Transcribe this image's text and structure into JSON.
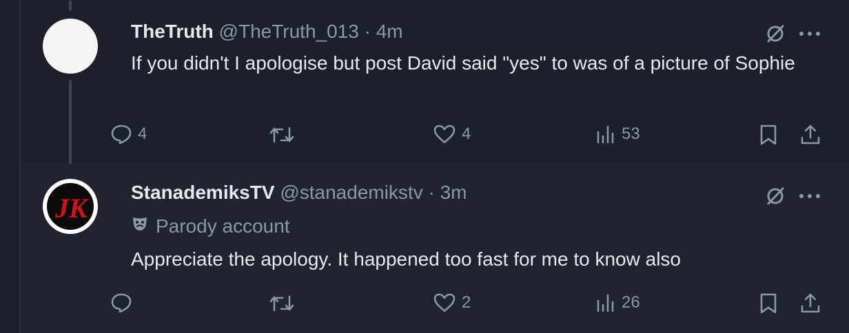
{
  "posts": [
    {
      "name": "TheTruth",
      "handle": "@TheTruth_013",
      "separator": "·",
      "time": "4m",
      "text": "If you didn't I apologise but post David said \"yes\" to was of a picture of Sophie",
      "replies": "4",
      "reposts": "",
      "likes": "4",
      "views": "53"
    },
    {
      "name": "StanademiksTV",
      "handle": "@stanademikstv",
      "separator": "·",
      "time": "3m",
      "badge": "Parody account",
      "text": "Appreciate the apology. It happened too fast for me to know also",
      "replies": "",
      "reposts": "",
      "likes": "2",
      "views": "26",
      "avatar_logo": "JK"
    }
  ],
  "colors": {
    "background": "#1b202a",
    "text": "#e7e9ea",
    "muted": "#8b98a5",
    "avatar_logo_red": "#d0121b"
  },
  "icons": [
    "grok-icon",
    "more-icon",
    "reply-icon",
    "repost-icon",
    "like-icon",
    "views-icon",
    "bookmark-icon",
    "share-icon",
    "parody-mask-icon"
  ]
}
